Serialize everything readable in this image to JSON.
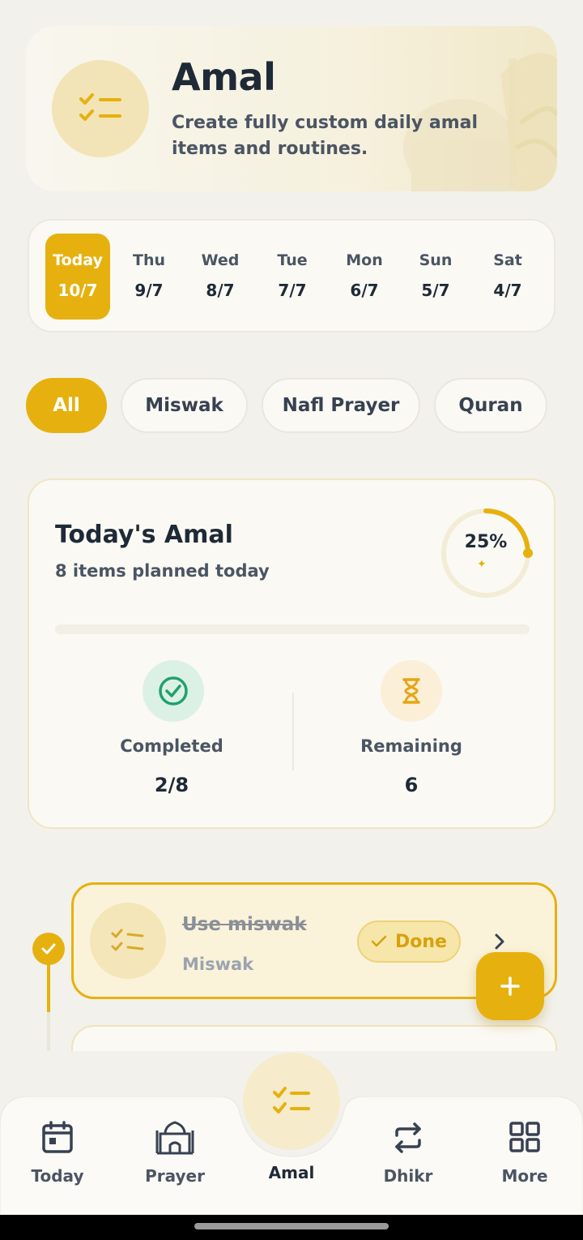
{
  "header": {
    "title": "Amal",
    "subtitle": "Create fully custom daily amal items and routines.",
    "icon": "checklist-icon"
  },
  "dates": [
    {
      "day": "Today",
      "date": "10/7",
      "active": true
    },
    {
      "day": "Thu",
      "date": "9/7",
      "active": false
    },
    {
      "day": "Wed",
      "date": "8/7",
      "active": false
    },
    {
      "day": "Tue",
      "date": "7/7",
      "active": false
    },
    {
      "day": "Mon",
      "date": "6/7",
      "active": false
    },
    {
      "day": "Sun",
      "date": "5/7",
      "active": false
    },
    {
      "day": "Sat",
      "date": "4/7",
      "active": false
    }
  ],
  "filters": [
    {
      "label": "All",
      "active": true
    },
    {
      "label": "Miswak",
      "active": false
    },
    {
      "label": "Nafl Prayer",
      "active": false
    },
    {
      "label": "Quran",
      "active": false
    }
  ],
  "summary": {
    "title": "Today's Amal",
    "subtitle": "8 items planned today",
    "progress_label": "25%",
    "progress": 0.25,
    "completed_label": "Completed",
    "completed_value": "2/8",
    "remaining_label": "Remaining",
    "remaining_value": "6"
  },
  "items": [
    {
      "title": "Use miswak",
      "category": "Miswak",
      "status": "Done",
      "completed": true
    }
  ],
  "fab": {
    "icon": "plus-icon"
  },
  "nav": {
    "items": [
      {
        "label": "Today",
        "icon": "calendar-icon"
      },
      {
        "label": "Prayer",
        "icon": "mosque-icon"
      },
      {
        "label": "Amal",
        "icon": "checklist-icon",
        "active": true
      },
      {
        "label": "Dhikr",
        "icon": "repeat-icon"
      },
      {
        "label": "More",
        "icon": "grid-icon"
      }
    ]
  },
  "colors": {
    "accent": "#e6b10f",
    "background": "#f2f1ec",
    "card": "#faf9f4",
    "success": "#22a06b"
  }
}
